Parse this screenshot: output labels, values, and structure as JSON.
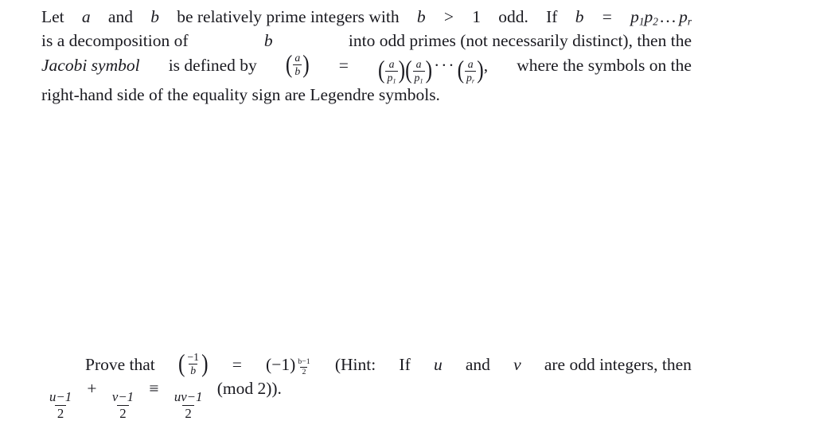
{
  "document": {
    "type": "math-textbook-excerpt",
    "background_color": "#ffffff",
    "text_color": "#1a1a20",
    "definition": {
      "line1": {
        "w1": "Let",
        "var_a": "a",
        "w2": "and",
        "var_b": "b",
        "w3": "be relatively prime integers with",
        "var_b2": "b",
        "gt": ">",
        "one": "1",
        "w4": "odd.",
        "w5": "If",
        "var_b3": "b",
        "eq": "=",
        "p1": "p",
        "p1sub": "1",
        "p2": "p",
        "p2sub": "2",
        "ellipsis": "...",
        "pr": "p",
        "prsub": "r"
      },
      "line2": {
        "w1": "is a decomposition of",
        "var_b": "b",
        "w2": "into odd primes (not necessarily distinct), then the"
      },
      "line3": {
        "term": "Jacobi symbol",
        "w1": "is defined by",
        "sym1_num": "a",
        "sym1_den": "b",
        "eq": "=",
        "sym2_num": "a",
        "sym2_den_base": "p",
        "sym2_den_sub": "1",
        "sym3_num": "a",
        "sym3_den_base": "p",
        "sym3_den_sub": "1",
        "ellipsis": "···",
        "sym4_num": "a",
        "sym4_den_base": "p",
        "sym4_den_sub": "r",
        "comma": ",",
        "w2": "where the symbols on the"
      },
      "line4": {
        "text": "right-hand side of the equality sign are Legendre symbols."
      }
    },
    "exercise": {
      "line1": {
        "w1": "Prove that",
        "sym_num": "−1",
        "sym_den": "b",
        "eq": "=",
        "base": "(−1)",
        "exp_num": "b−1",
        "exp_den": "2",
        "hint_open": "(Hint:",
        "w2": "If",
        "var_u": "u",
        "w3": "and",
        "var_v": "v",
        "w4": "are odd integers, then"
      },
      "line2": {
        "f1_num": "u−1",
        "f1_den": "2",
        "plus": "+",
        "f2_num": "v−1",
        "f2_den": "2",
        "equiv": "≡",
        "f3_num": "uv−1",
        "f3_den": "2",
        "mod": "(mod 2)).",
        "mod_text": "mod",
        "mod_value": "2"
      }
    }
  }
}
